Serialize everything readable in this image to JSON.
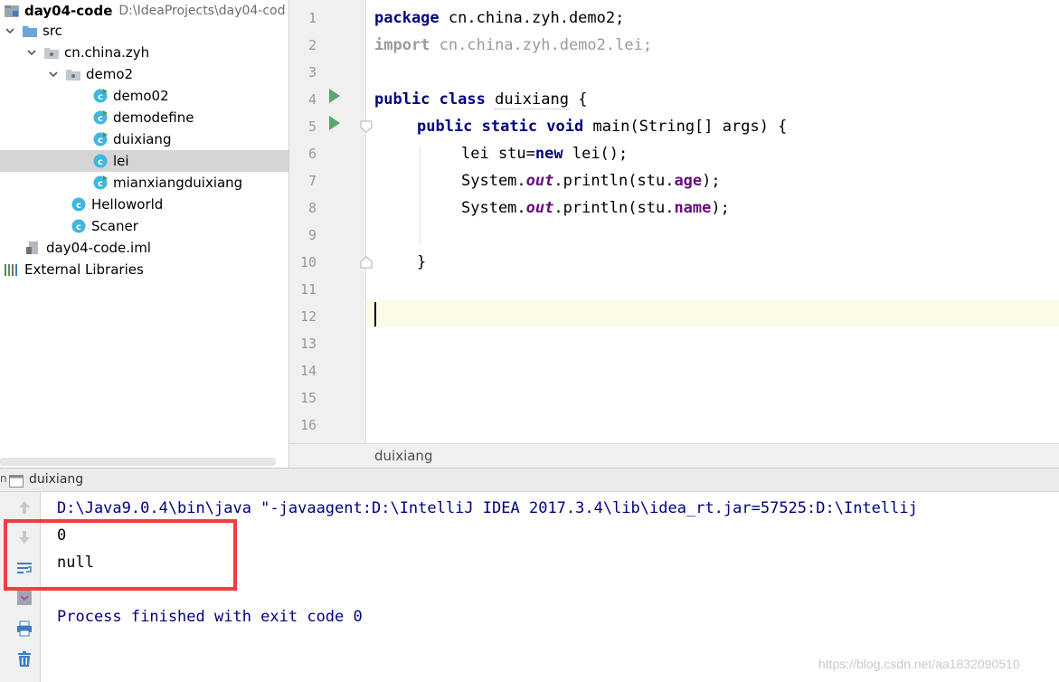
{
  "project_tree": {
    "root_name": "day04-code",
    "root_path": "D:\\IdeaProjects\\day04-cod",
    "items": [
      {
        "label": "src"
      },
      {
        "label": "cn.china.zyh"
      },
      {
        "label": "demo2"
      },
      {
        "label": "demo02"
      },
      {
        "label": "demodefine"
      },
      {
        "label": "duixiang"
      },
      {
        "label": "lei"
      },
      {
        "label": "mianxiangduixiang"
      },
      {
        "label": "Helloworld"
      },
      {
        "label": "Scaner"
      },
      {
        "label": "day04-code.iml"
      },
      {
        "label": "External Libraries"
      }
    ],
    "selected": "lei"
  },
  "editor": {
    "line_numbers": [
      "1",
      "2",
      "3",
      "4",
      "5",
      "6",
      "7",
      "8",
      "9",
      "10",
      "11",
      "12",
      "13",
      "14",
      "15",
      "16"
    ],
    "current_line": "12",
    "code": {
      "l1_kw": "package",
      "l1_rest": " cn.china.zyh.demo2;",
      "l2_kw": "import",
      "l2_rest": " cn.china.zyh.demo2.lei;",
      "l4_kw": "public class",
      "l4_name": "duixiang",
      "l4_rest": " {",
      "l5_kw": "public static void",
      "l5_rest": " main(String[] args) {",
      "l6_a": "lei stu=",
      "l6_kw": "new",
      "l6_b": " lei();",
      "l7_a": "System.",
      "l7_out": "out",
      "l7_b": ".println(stu.",
      "l7_field": "age",
      "l7_c": ");",
      "l8_a": "System.",
      "l8_out": "out",
      "l8_b": ".println(stu.",
      "l8_field": "name",
      "l8_c": ");",
      "l10": "}"
    },
    "breadcrumb": "duixiang"
  },
  "run_panel": {
    "edge_fragment": "n",
    "tab_label": "duixiang",
    "console": {
      "command": "D:\\Java9.0.4\\bin\\java \"-javaagent:D:\\IntelliJ IDEA 2017.3.4\\lib\\idea_rt.jar=57525:D:\\Intellij",
      "output": [
        "0",
        "null"
      ],
      "process_message": "Process finished with exit code 0"
    },
    "toolbar_icons": [
      "up-arrow-icon",
      "down-arrow-icon",
      "soft-wrap-icon",
      "scroll-to-end-icon",
      "print-icon",
      "trash-icon"
    ]
  },
  "annotation": {
    "box_color": "#f23e3e"
  },
  "watermark": "https://blog.csdn.net/aa1832090510",
  "colors": {
    "keyword": "#000080",
    "field": "#660e7a",
    "caret_line": "#fdfae8",
    "gutter": "#f0f0f0",
    "selection": "#d5d5d5"
  }
}
